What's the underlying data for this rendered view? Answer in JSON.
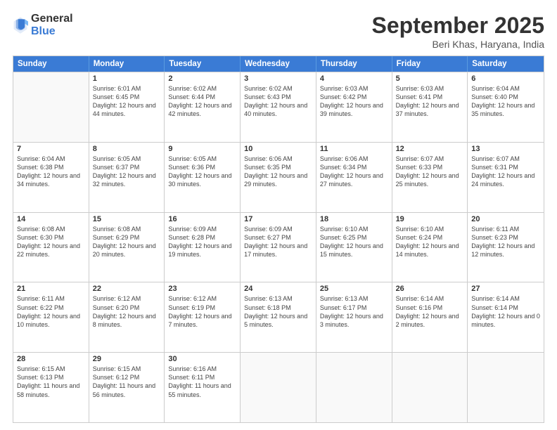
{
  "logo": {
    "general": "General",
    "blue": "Blue"
  },
  "header": {
    "month": "September 2025",
    "location": "Beri Khas, Haryana, India"
  },
  "days": [
    "Sunday",
    "Monday",
    "Tuesday",
    "Wednesday",
    "Thursday",
    "Friday",
    "Saturday"
  ],
  "weeks": [
    [
      {
        "day": "",
        "sunrise": "",
        "sunset": "",
        "daylight": ""
      },
      {
        "day": "1",
        "sunrise": "Sunrise: 6:01 AM",
        "sunset": "Sunset: 6:45 PM",
        "daylight": "Daylight: 12 hours and 44 minutes."
      },
      {
        "day": "2",
        "sunrise": "Sunrise: 6:02 AM",
        "sunset": "Sunset: 6:44 PM",
        "daylight": "Daylight: 12 hours and 42 minutes."
      },
      {
        "day": "3",
        "sunrise": "Sunrise: 6:02 AM",
        "sunset": "Sunset: 6:43 PM",
        "daylight": "Daylight: 12 hours and 40 minutes."
      },
      {
        "day": "4",
        "sunrise": "Sunrise: 6:03 AM",
        "sunset": "Sunset: 6:42 PM",
        "daylight": "Daylight: 12 hours and 39 minutes."
      },
      {
        "day": "5",
        "sunrise": "Sunrise: 6:03 AM",
        "sunset": "Sunset: 6:41 PM",
        "daylight": "Daylight: 12 hours and 37 minutes."
      },
      {
        "day": "6",
        "sunrise": "Sunrise: 6:04 AM",
        "sunset": "Sunset: 6:40 PM",
        "daylight": "Daylight: 12 hours and 35 minutes."
      }
    ],
    [
      {
        "day": "7",
        "sunrise": "Sunrise: 6:04 AM",
        "sunset": "Sunset: 6:38 PM",
        "daylight": "Daylight: 12 hours and 34 minutes."
      },
      {
        "day": "8",
        "sunrise": "Sunrise: 6:05 AM",
        "sunset": "Sunset: 6:37 PM",
        "daylight": "Daylight: 12 hours and 32 minutes."
      },
      {
        "day": "9",
        "sunrise": "Sunrise: 6:05 AM",
        "sunset": "Sunset: 6:36 PM",
        "daylight": "Daylight: 12 hours and 30 minutes."
      },
      {
        "day": "10",
        "sunrise": "Sunrise: 6:06 AM",
        "sunset": "Sunset: 6:35 PM",
        "daylight": "Daylight: 12 hours and 29 minutes."
      },
      {
        "day": "11",
        "sunrise": "Sunrise: 6:06 AM",
        "sunset": "Sunset: 6:34 PM",
        "daylight": "Daylight: 12 hours and 27 minutes."
      },
      {
        "day": "12",
        "sunrise": "Sunrise: 6:07 AM",
        "sunset": "Sunset: 6:33 PM",
        "daylight": "Daylight: 12 hours and 25 minutes."
      },
      {
        "day": "13",
        "sunrise": "Sunrise: 6:07 AM",
        "sunset": "Sunset: 6:31 PM",
        "daylight": "Daylight: 12 hours and 24 minutes."
      }
    ],
    [
      {
        "day": "14",
        "sunrise": "Sunrise: 6:08 AM",
        "sunset": "Sunset: 6:30 PM",
        "daylight": "Daylight: 12 hours and 22 minutes."
      },
      {
        "day": "15",
        "sunrise": "Sunrise: 6:08 AM",
        "sunset": "Sunset: 6:29 PM",
        "daylight": "Daylight: 12 hours and 20 minutes."
      },
      {
        "day": "16",
        "sunrise": "Sunrise: 6:09 AM",
        "sunset": "Sunset: 6:28 PM",
        "daylight": "Daylight: 12 hours and 19 minutes."
      },
      {
        "day": "17",
        "sunrise": "Sunrise: 6:09 AM",
        "sunset": "Sunset: 6:27 PM",
        "daylight": "Daylight: 12 hours and 17 minutes."
      },
      {
        "day": "18",
        "sunrise": "Sunrise: 6:10 AM",
        "sunset": "Sunset: 6:25 PM",
        "daylight": "Daylight: 12 hours and 15 minutes."
      },
      {
        "day": "19",
        "sunrise": "Sunrise: 6:10 AM",
        "sunset": "Sunset: 6:24 PM",
        "daylight": "Daylight: 12 hours and 14 minutes."
      },
      {
        "day": "20",
        "sunrise": "Sunrise: 6:11 AM",
        "sunset": "Sunset: 6:23 PM",
        "daylight": "Daylight: 12 hours and 12 minutes."
      }
    ],
    [
      {
        "day": "21",
        "sunrise": "Sunrise: 6:11 AM",
        "sunset": "Sunset: 6:22 PM",
        "daylight": "Daylight: 12 hours and 10 minutes."
      },
      {
        "day": "22",
        "sunrise": "Sunrise: 6:12 AM",
        "sunset": "Sunset: 6:20 PM",
        "daylight": "Daylight: 12 hours and 8 minutes."
      },
      {
        "day": "23",
        "sunrise": "Sunrise: 6:12 AM",
        "sunset": "Sunset: 6:19 PM",
        "daylight": "Daylight: 12 hours and 7 minutes."
      },
      {
        "day": "24",
        "sunrise": "Sunrise: 6:13 AM",
        "sunset": "Sunset: 6:18 PM",
        "daylight": "Daylight: 12 hours and 5 minutes."
      },
      {
        "day": "25",
        "sunrise": "Sunrise: 6:13 AM",
        "sunset": "Sunset: 6:17 PM",
        "daylight": "Daylight: 12 hours and 3 minutes."
      },
      {
        "day": "26",
        "sunrise": "Sunrise: 6:14 AM",
        "sunset": "Sunset: 6:16 PM",
        "daylight": "Daylight: 12 hours and 2 minutes."
      },
      {
        "day": "27",
        "sunrise": "Sunrise: 6:14 AM",
        "sunset": "Sunset: 6:14 PM",
        "daylight": "Daylight: 12 hours and 0 minutes."
      }
    ],
    [
      {
        "day": "28",
        "sunrise": "Sunrise: 6:15 AM",
        "sunset": "Sunset: 6:13 PM",
        "daylight": "Daylight: 11 hours and 58 minutes."
      },
      {
        "day": "29",
        "sunrise": "Sunrise: 6:15 AM",
        "sunset": "Sunset: 6:12 PM",
        "daylight": "Daylight: 11 hours and 56 minutes."
      },
      {
        "day": "30",
        "sunrise": "Sunrise: 6:16 AM",
        "sunset": "Sunset: 6:11 PM",
        "daylight": "Daylight: 11 hours and 55 minutes."
      },
      {
        "day": "",
        "sunrise": "",
        "sunset": "",
        "daylight": ""
      },
      {
        "day": "",
        "sunrise": "",
        "sunset": "",
        "daylight": ""
      },
      {
        "day": "",
        "sunrise": "",
        "sunset": "",
        "daylight": ""
      },
      {
        "day": "",
        "sunrise": "",
        "sunset": "",
        "daylight": ""
      }
    ]
  ]
}
